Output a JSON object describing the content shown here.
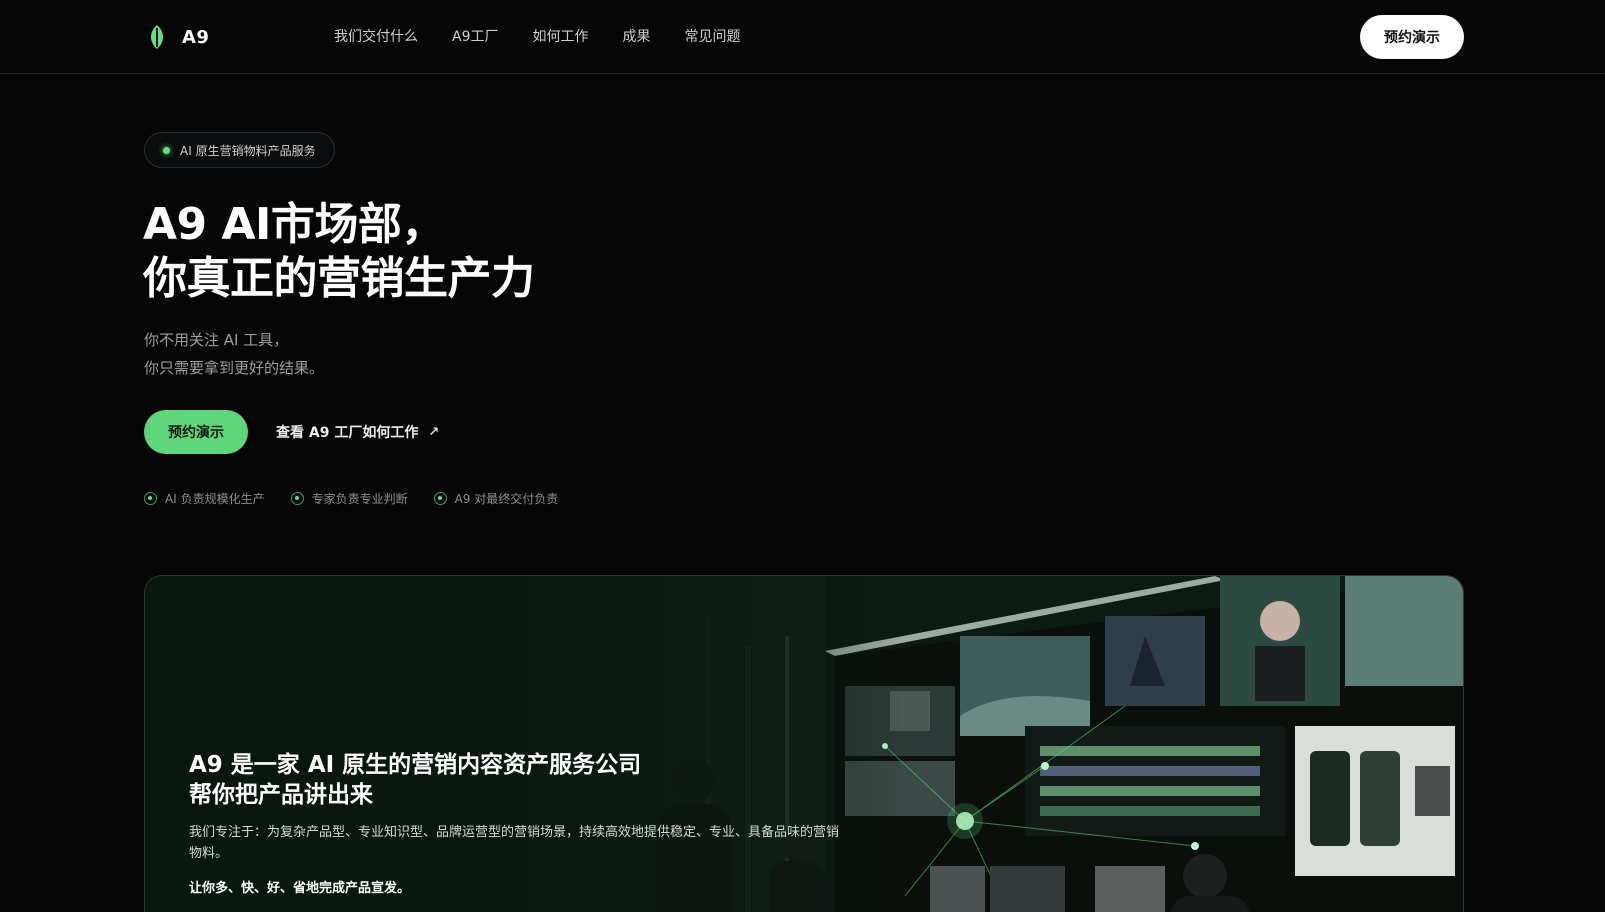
{
  "header": {
    "logo_text": "A9",
    "nav": [
      {
        "label": "我们交付什么"
      },
      {
        "label": "A9工厂"
      },
      {
        "label": "如何工作"
      },
      {
        "label": "成果"
      },
      {
        "label": "常见问题"
      }
    ],
    "cta_label": "预约演示"
  },
  "hero": {
    "badge": "AI 原生营销物料产品服务",
    "title_line1": "A9 AI市场部，",
    "title_line2": "你真正的营销生产力",
    "sub_line1": "你不用关注 AI 工具，",
    "sub_line2": "你只需要拿到更好的结果。",
    "primary_cta": "预约演示",
    "secondary_cta": "查看 A9 工厂如何工作",
    "secondary_icon": "arrow-up-right-icon",
    "features": [
      {
        "label": "AI 负责规模化生产"
      },
      {
        "label": "专家负责专业判断"
      },
      {
        "label": "A9 对最终交付负责"
      }
    ]
  },
  "showcase": {
    "title_line1": "A9 是一家 AI 原生的营销内容资产服务公司",
    "title_line2": "帮你把产品讲出来",
    "description": "我们专注于：为复杂产品型、专业知识型、品牌运营型的营销场景，持续高效地提供稳定、专业、具备品味的营销物料。",
    "emphasis": "让你多、快、好、省地完成产品宣发。"
  },
  "colors": {
    "background": "#060607",
    "accent_green": "#5fd67a",
    "text_primary": "#ffffff",
    "text_muted": "#9d9d9d"
  }
}
